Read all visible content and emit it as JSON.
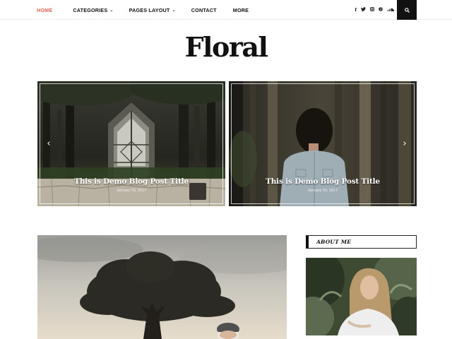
{
  "nav": {
    "items": [
      {
        "label": "HOME",
        "active": true,
        "dropdown": false
      },
      {
        "label": "CATEGORIES",
        "active": false,
        "dropdown": true
      },
      {
        "label": "PAGES LAYOUT",
        "active": false,
        "dropdown": true
      },
      {
        "label": "CONTACT",
        "active": false,
        "dropdown": false
      },
      {
        "label": "MORE",
        "active": false,
        "dropdown": false
      }
    ],
    "social_icons": [
      "facebook-icon",
      "twitter-icon",
      "instagram-icon",
      "pinterest-icon",
      "soundcloud-icon"
    ],
    "search_icon": "search-icon",
    "active_color": "#e0645a"
  },
  "site": {
    "logo": "Floral"
  },
  "slider": {
    "slides": [
      {
        "title": "This is Demo Blog Post Title",
        "date": "January 03, 2017"
      },
      {
        "title": "This is Demo Blog Post Title",
        "date": "January 03, 2017"
      }
    ],
    "prev_icon": "chevron-left-icon",
    "next_icon": "chevron-right-icon"
  },
  "sidebar": {
    "about_title": "ABOUT ME"
  }
}
